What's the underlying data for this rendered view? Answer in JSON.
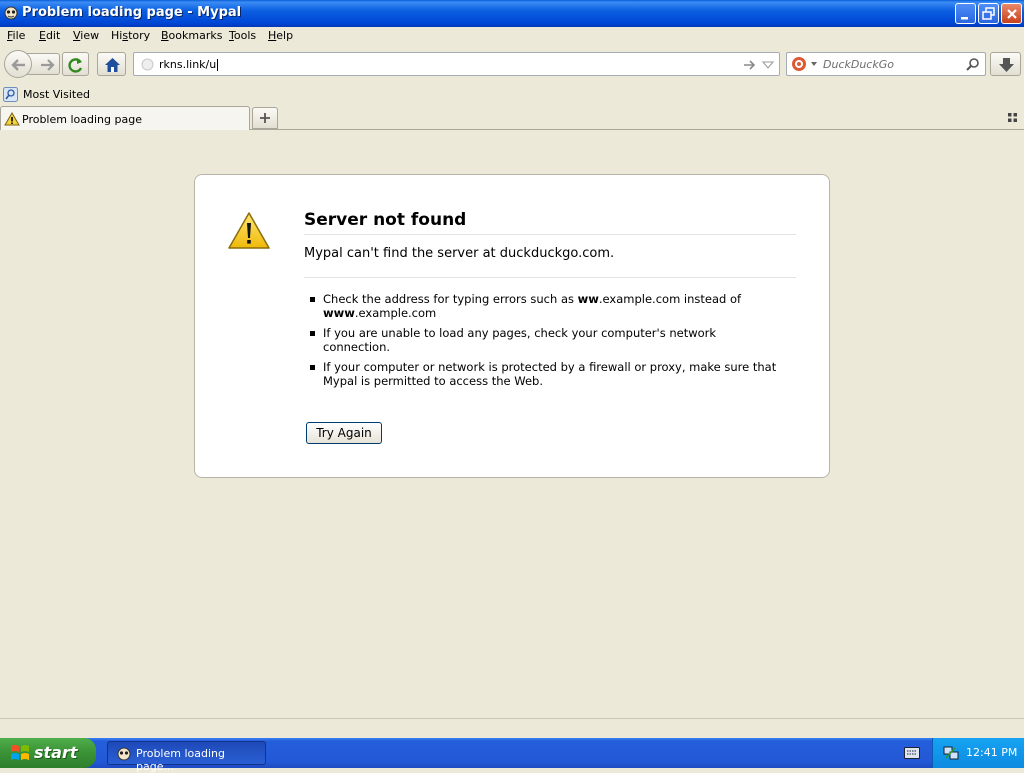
{
  "window": {
    "title": "Problem loading page - Mypal"
  },
  "menu": {
    "items": [
      {
        "pre": "",
        "key": "F",
        "post": "ile"
      },
      {
        "pre": "",
        "key": "E",
        "post": "dit"
      },
      {
        "pre": "",
        "key": "V",
        "post": "iew"
      },
      {
        "pre": "Hi",
        "key": "s",
        "post": "tory"
      },
      {
        "pre": "",
        "key": "B",
        "post": "ookmarks"
      },
      {
        "pre": "",
        "key": "T",
        "post": "ools"
      },
      {
        "pre": "",
        "key": "H",
        "post": "elp"
      }
    ]
  },
  "nav": {
    "url": "rkns.link/u",
    "search_placeholder": "DuckDuckGo"
  },
  "bookmarks": {
    "most_visited": "Most Visited"
  },
  "tabs": [
    {
      "label": "Problem loading page"
    }
  ],
  "error": {
    "title": "Server not found",
    "description": "Mypal can't find the server at duckduckgo.com.",
    "tips": [
      {
        "parts": [
          "Check the address for typing errors such as ",
          "ww",
          ".example.com instead of ",
          "www",
          ".example.com"
        ]
      },
      {
        "parts": [
          "If you are unable to load any pages, check your computer's network connection."
        ]
      },
      {
        "parts": [
          "If your computer or network is protected by a firewall or proxy, make sure that Mypal is permitted to access the Web."
        ]
      }
    ],
    "button_label": "Try Again"
  },
  "taskbar": {
    "start_label": "start",
    "task_label": "Problem loading page...",
    "clock": "12:41 PM"
  },
  "colors": {
    "titlebar": "#0054e3",
    "chrome": "#ece9d8",
    "taskbar": "#245edb",
    "start": "#3a9236",
    "tray": "#0d8ae0"
  }
}
